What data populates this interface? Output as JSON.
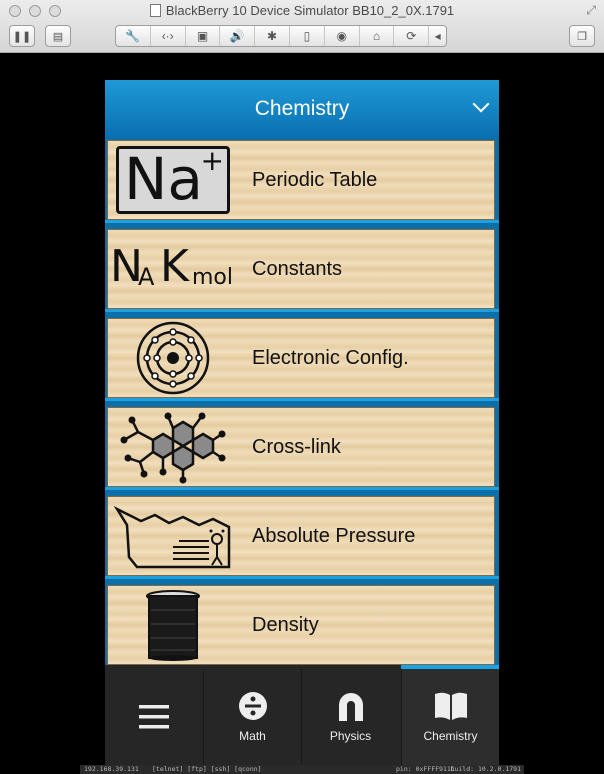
{
  "window": {
    "title": "BlackBerry 10 Device Simulator BB10_2_0X.1791"
  },
  "toolbar": {
    "buttons": [
      "pause-icon",
      "screenshot-icon",
      "settings-icon",
      "swipe-icon",
      "battery-icon",
      "volume-icon",
      "bluetooth-icon",
      "device-icon",
      "camera-icon",
      "mouse-icon",
      "rotate-icon",
      "back-icon",
      "window-icon"
    ]
  },
  "screen": {
    "header": {
      "title": "Chemistry"
    },
    "items": [
      {
        "label": "Periodic Table",
        "icon_text": "Na",
        "icon_sup": "+"
      },
      {
        "label": "Constants",
        "icon_text_n": "N",
        "icon_text_a": "A",
        "icon_text_k": "K",
        "icon_text_mol": "mol"
      },
      {
        "label": "Electronic Config."
      },
      {
        "label": "Cross-link"
      },
      {
        "label": "Absolute Pressure"
      },
      {
        "label": "Density"
      }
    ],
    "nav": [
      {
        "label": "",
        "icon": "menu-icon"
      },
      {
        "label": "Math",
        "icon": "divide-icon"
      },
      {
        "label": "Physics",
        "icon": "magnet-icon"
      },
      {
        "label": "Chemistry",
        "icon": "book-icon",
        "active": true
      }
    ],
    "colors": {
      "header": "#1e9ad6",
      "accent": "#16a4e4",
      "nav_bg": "#262626"
    }
  },
  "statusbar": {
    "ip": "192.168.39.131",
    "services": "[telnet]  [ftp]  [ssh]  [qconn]",
    "pin": "pin: 0xFFFF911C",
    "build": "build: 10.2.0.1791"
  }
}
